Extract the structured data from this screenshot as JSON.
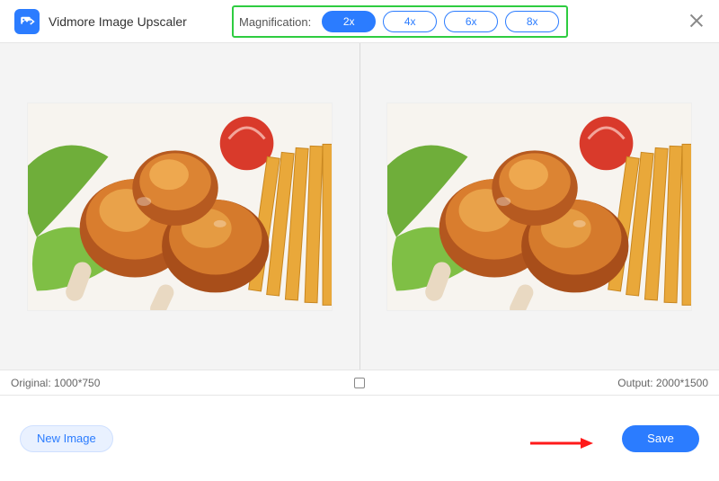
{
  "header": {
    "app_title": "Vidmore Image Upscaler",
    "magnification_label": "Magnification:",
    "options": [
      {
        "label": "2x",
        "active": true
      },
      {
        "label": "4x",
        "active": false
      },
      {
        "label": "6x",
        "active": false
      },
      {
        "label": "8x",
        "active": false
      }
    ]
  },
  "dimensions": {
    "original_label": "Original: 1000*750",
    "output_label": "Output: 2000*1500"
  },
  "footer": {
    "new_image_label": "New Image",
    "save_label": "Save"
  }
}
